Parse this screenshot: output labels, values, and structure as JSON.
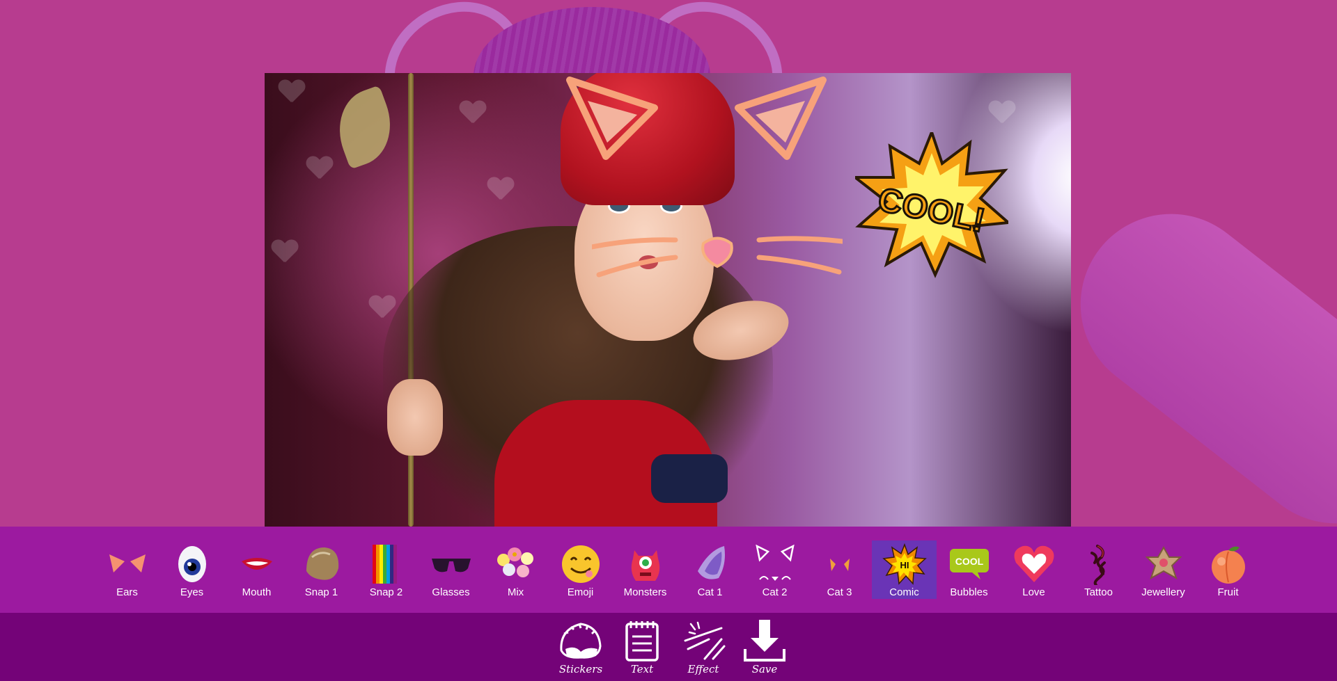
{
  "stickers": {
    "items": [
      {
        "label": "Ears",
        "icon": "ears-icon"
      },
      {
        "label": "Eyes",
        "icon": "eye-icon"
      },
      {
        "label": "Mouth",
        "icon": "mouth-icon"
      },
      {
        "label": "Snap 1",
        "icon": "hair-icon"
      },
      {
        "label": "Snap 2",
        "icon": "rainbow-icon"
      },
      {
        "label": "Glasses",
        "icon": "glasses-icon"
      },
      {
        "label": "Mix",
        "icon": "flower-crown-icon"
      },
      {
        "label": "Emoji",
        "icon": "smiley-icon"
      },
      {
        "label": "Monsters",
        "icon": "monster-icon"
      },
      {
        "label": "Cat 1",
        "icon": "cat-ear-icon"
      },
      {
        "label": "Cat 2",
        "icon": "cat-face-icon"
      },
      {
        "label": "Cat 3",
        "icon": "small-cat-ears-icon"
      },
      {
        "label": "Comic",
        "icon": "comic-burst-icon",
        "selected": true
      },
      {
        "label": "Bubbles",
        "icon": "speech-bubble-icon"
      },
      {
        "label": "Love",
        "icon": "heart-icon"
      },
      {
        "label": "Tattoo",
        "icon": "dragon-tattoo-icon"
      },
      {
        "label": "Jewellery",
        "icon": "jewel-icon"
      },
      {
        "label": "Fruit",
        "icon": "peach-icon"
      }
    ]
  },
  "tools": {
    "stickers": "Stickers",
    "text": "Text",
    "effect": "Effect",
    "save": "Save"
  },
  "canvas": {
    "sticker_text": "COOL!",
    "comic_badge": "HI",
    "bubble_badge": "COOL"
  },
  "colors": {
    "background": "#b73c8f",
    "sticker_bar": "#9c1aa0",
    "toolbar": "#740378",
    "selected": "#6a34b6"
  }
}
